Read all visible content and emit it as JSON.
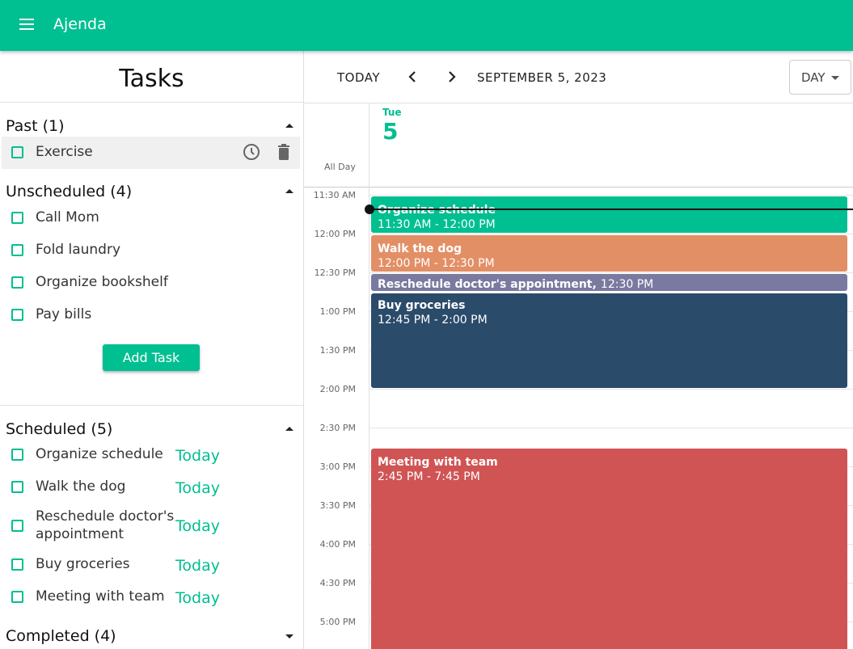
{
  "app": {
    "title": "Ajenda"
  },
  "sidebar": {
    "title": "Tasks",
    "past": {
      "label": "Past (1)",
      "tasks": [
        {
          "label": "Exercise"
        }
      ]
    },
    "unscheduled": {
      "label": "Unscheduled (4)",
      "tasks": [
        {
          "label": "Call Mom"
        },
        {
          "label": "Fold laundry"
        },
        {
          "label": "Organize bookshelf"
        },
        {
          "label": "Pay bills"
        }
      ]
    },
    "add_task_label": "Add Task",
    "scheduled": {
      "label": "Scheduled (5)",
      "tasks": [
        {
          "label": "Organize schedule",
          "when": "Today"
        },
        {
          "label": "Walk the dog",
          "when": "Today"
        },
        {
          "label": "Reschedule doctor's appointment",
          "when": "Today"
        },
        {
          "label": "Buy groceries",
          "when": "Today"
        },
        {
          "label": "Meeting with team",
          "when": "Today"
        }
      ]
    },
    "completed": {
      "label": "Completed (4)"
    }
  },
  "calendar": {
    "today_label": "TODAY",
    "date_label": "SEPTEMBER 5, 2023",
    "view_label": "DAY",
    "day_name": "Tue",
    "day_number": "5",
    "all_day_label": "All Day",
    "time_slots": [
      "11:30 AM",
      "12:00 PM",
      "12:30 PM",
      "1:00 PM",
      "1:30 PM",
      "2:00 PM",
      "2:30 PM",
      "3:00 PM",
      "3:30 PM",
      "4:00 PM",
      "4:30 PM",
      "5:00 PM"
    ],
    "events": [
      {
        "title": "Organize schedule",
        "time": "11:30 AM  -  12:00 PM",
        "color": "#00bf91"
      },
      {
        "title": "Walk the dog",
        "time": "12:00 PM  -  12:30 PM",
        "color": "#e38f65"
      },
      {
        "title": "Reschedule doctor's appointment,",
        "time": "12:30 PM",
        "color": "#7a7aa0"
      },
      {
        "title": "Buy groceries",
        "time": "12:45 PM  -  2:00 PM",
        "color": "#2b4b6a"
      },
      {
        "title": "Meeting with team",
        "time": "2:45 PM  -  7:45 PM",
        "color": "#d05454"
      }
    ]
  },
  "colors": {
    "brand": "#00bf91",
    "text": "#222222"
  }
}
